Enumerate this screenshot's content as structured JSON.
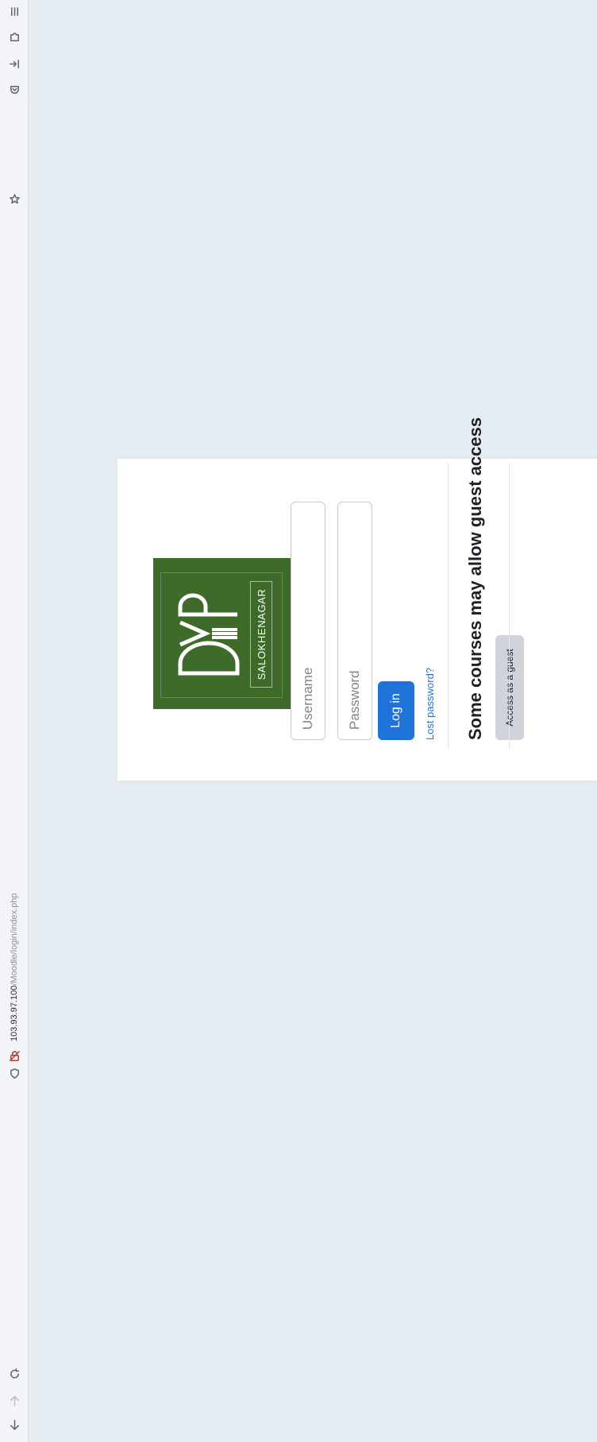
{
  "browser": {
    "url_host": "103.93.97.100",
    "url_path": "/Moodle/login/index.php",
    "icons": [
      "back-arrow-icon",
      "forward-arrow-icon",
      "reload-icon",
      "shield-icon",
      "insecure-connection-icon",
      "bookmark-star-icon",
      "pocket-icon",
      "sign-in-icon",
      "extensions-icon",
      "menu-icon"
    ]
  },
  "login": {
    "logo_text": "SALOKHENAGAR",
    "username_placeholder": "Username",
    "password_placeholder": "Password",
    "login_button": "Log in",
    "lost_password": "Lost password?",
    "guest_heading": "Some courses may allow guest access",
    "guest_button": "Access as a guest"
  },
  "colors": {
    "page_background": "#e6edf2",
    "brand_green": "#3e6a2a",
    "primary_button": "#1f73d8",
    "link": "#1f73d8",
    "secondary_button": "#ced4da"
  }
}
